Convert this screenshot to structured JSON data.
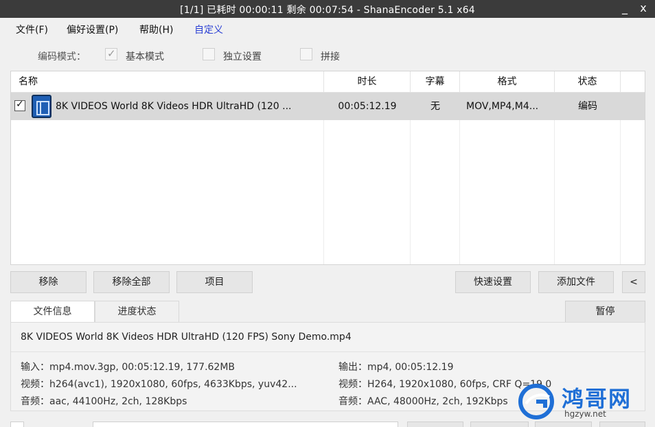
{
  "window": {
    "title": "[1/1] 已耗时 00:00:11  剩余 00:07:54 - ShanaEncoder 5.1 x64",
    "minimize": "_",
    "close": "x"
  },
  "menu": {
    "file": "文件(F)",
    "prefs": "偏好设置(P)",
    "help": "帮助(H)",
    "custom": "自定义"
  },
  "mode": {
    "label": "编码模式：",
    "basic": "基本模式",
    "basic_checked": true,
    "independent": "独立设置",
    "independent_checked": false,
    "concat": "拼接",
    "concat_checked": false
  },
  "table": {
    "headers": [
      "名称",
      "时长",
      "字幕",
      "格式",
      "状态"
    ],
    "rows": [
      {
        "checked": true,
        "icon": "video-file-icon",
        "name": "8K VIDEOS   World 8K Videos HDR UltraHD  (120 ...",
        "duration": "00:05:12.19",
        "subtitle": "无",
        "format": "MOV,MP4,M4...",
        "status": "编码"
      }
    ]
  },
  "buttons": {
    "remove": "移除",
    "remove_all": "移除全部",
    "item": "项目",
    "quick_settings": "快速设置",
    "add_file": "添加文件",
    "collapse": "<",
    "pause": "暂停"
  },
  "tabs": {
    "file_info": "文件信息",
    "progress": "进度状态"
  },
  "info": {
    "filename": "8K VIDEOS   World 8K Videos HDR UltraHD  (120 FPS)  Sony Demo.mp4",
    "input": "输入：mp4.mov.3gp, 00:05:12.19, 177.62MB",
    "input_video": "视频：h264(avc1), 1920x1080, 60fps, 4633Kbps,  yuv42...",
    "input_audio": "音频：aac, 44100Hz, 2ch, 128Kbps",
    "output": "输出：mp4, 00:05:12.19",
    "output_video": "视频：H264, 1920x1080, 60fps, CRF Q=19.0",
    "output_audio": "音频：AAC, 48000Hz, 2ch, 192Kbps"
  },
  "watermark": {
    "brand": "鸿哥网",
    "url": "hgzyw.net"
  },
  "colors": {
    "titlebar": "#3b3b3b",
    "selected_row": "#d9d9d9",
    "custom_menu": "#2a3fd4",
    "brand": "#1f6fd6"
  }
}
